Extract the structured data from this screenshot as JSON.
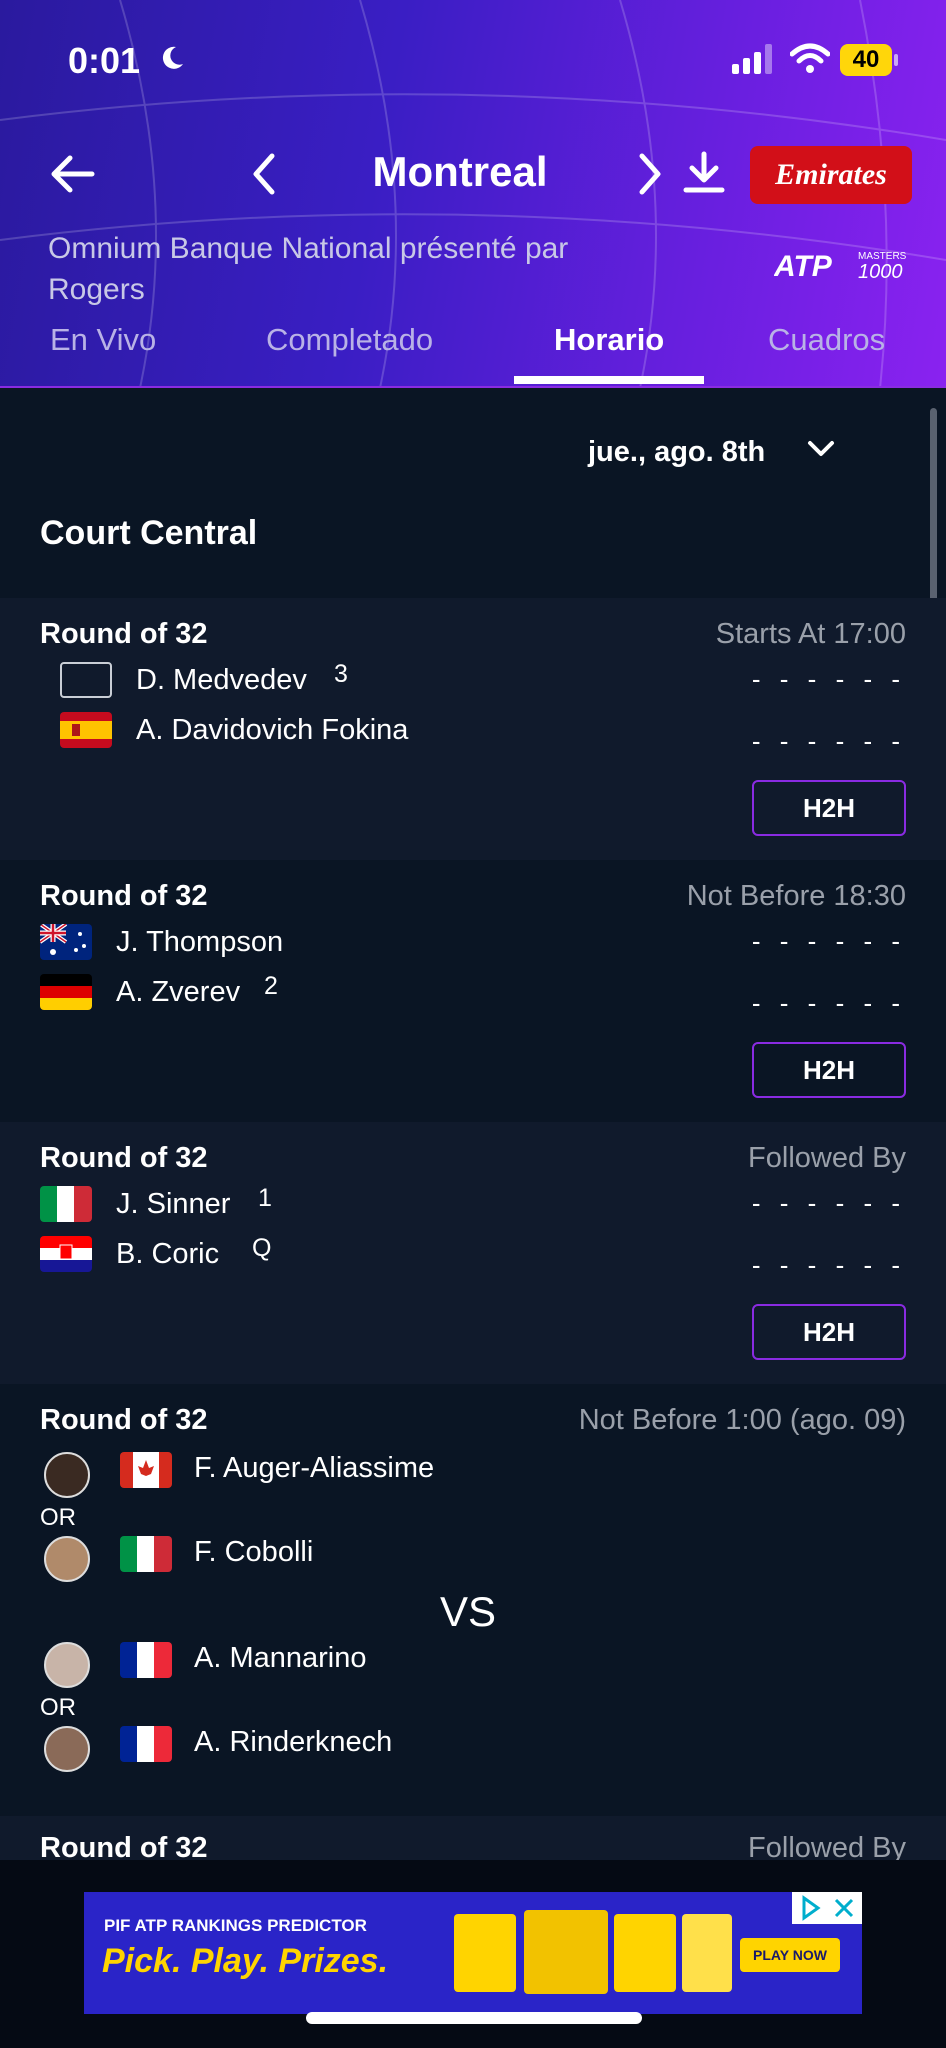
{
  "status_bar": {
    "time": "0:01",
    "battery": "40"
  },
  "header": {
    "title": "Montreal",
    "sponsor": "Emirates",
    "subtitle": "Omnium Banque National présenté par Rogers",
    "atp_logo_text": "ATP",
    "atp_tier": "MASTERS 1000"
  },
  "tabs": [
    {
      "label": "En Vivo"
    },
    {
      "label": "Completado"
    },
    {
      "label": "Horario",
      "active": true
    },
    {
      "label": "Cuadros"
    }
  ],
  "date_selector": {
    "value": "jue., ago. 8th"
  },
  "court": "Court Central",
  "matches": [
    {
      "round": "Round of 32",
      "when": "Starts At 17:00",
      "players": [
        {
          "name": "D. Medvedev",
          "seed": "3",
          "flag": "none",
          "score": "- - - - - -"
        },
        {
          "name": "A. Davidovich Fokina",
          "seed": "",
          "flag": "ESP",
          "score": "- - - - - -"
        }
      ],
      "h2h": "H2H"
    },
    {
      "round": "Round of 32",
      "when": "Not Before 18:30",
      "players": [
        {
          "name": "J. Thompson",
          "seed": "",
          "flag": "AUS",
          "score": "- - - - - -"
        },
        {
          "name": "A. Zverev",
          "seed": "2",
          "flag": "GER",
          "score": "- - - - - -"
        }
      ],
      "h2h": "H2H"
    },
    {
      "round": "Round of 32",
      "when": "Followed By",
      "players": [
        {
          "name": "J. Sinner",
          "seed": "1",
          "flag": "ITA",
          "score": "- - - - - -"
        },
        {
          "name": "B. Coric",
          "seed": "Q",
          "flag": "CRO",
          "score": "- - - - - -"
        }
      ],
      "h2h": "H2H"
    },
    {
      "round": "Round of 32",
      "when": "Not Before 1:00 (ago. 09)",
      "players": [
        {
          "name": "F. Auger-Aliassime",
          "flag": "CAN"
        },
        {
          "name": "F. Cobolli",
          "flag": "ITA"
        },
        {
          "name": "A. Mannarino",
          "flag": "FRA"
        },
        {
          "name": "A. Rinderknech",
          "flag": "FRA"
        }
      ],
      "or_label": "OR",
      "vs_label": "VS"
    },
    {
      "round": "Round of 32",
      "when": "Followed By"
    }
  ],
  "ad": {
    "top_line": "PIF ATP RANKINGS PREDICTOR",
    "headline": "Pick. Play. Prizes.",
    "button": "PLAY NOW"
  },
  "colors": {
    "accent": "#8a2be2",
    "header_start": "#2a1a9e",
    "header_end": "#8a22f0",
    "sponsor": "#d20f18"
  }
}
